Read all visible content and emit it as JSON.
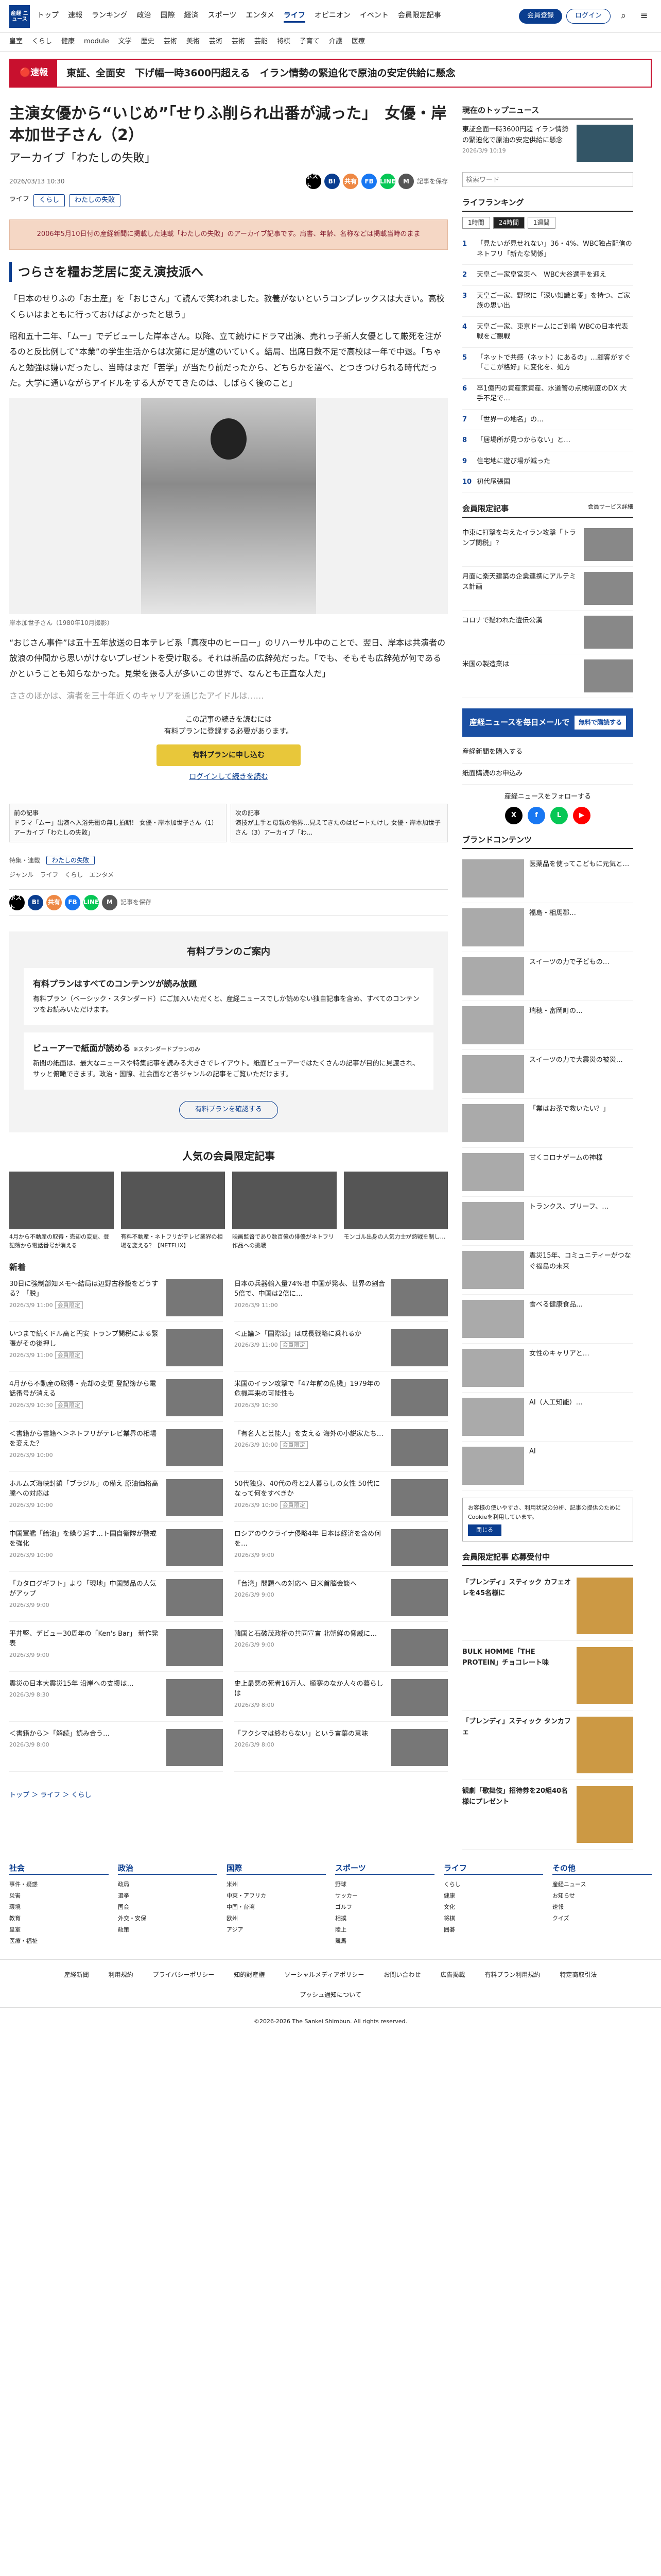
{
  "header": {
    "logo": "産経\nニュース",
    "nav": [
      "トップ",
      "速報",
      "ランキング",
      "政治",
      "国際",
      "経済",
      "スポーツ",
      "エンタメ",
      "ライフ",
      "オピニオン",
      "イベント",
      "会員限定記事"
    ],
    "active": "ライフ",
    "member": "会員登録",
    "login": "ログイン",
    "menu": "メニュー"
  },
  "subnav": [
    "皇室",
    "くらし",
    "健康",
    "module",
    "文学",
    "歴史",
    "芸術",
    "美術",
    "芸術",
    "芸術",
    "芸能",
    "将棋",
    "子育て",
    "介護",
    "医療"
  ],
  "breaking": {
    "label": "速報",
    "text": "東証、全面安　下げ幅一時3600円超える　イラン情勢の緊迫化で原油の安定供給に懸念"
  },
  "article": {
    "title": "主演女優から“いじめ”「せりふ削られ出番が減った」　女優・岸本加世子さん（2）",
    "subtitle": "アーカイブ「わたしの失敗」",
    "date": "2026/03/13 10:30",
    "share": [
      "ポスト",
      "B!",
      "共有",
      "FB",
      "LINE",
      "M",
      "記事を保存"
    ],
    "tags": [
      "ライフ",
      "くらし",
      "わたしの失敗"
    ],
    "notice": "2006年5月10日付の産経新聞に掲載した連載「わたしの失敗」のアーカイブ記事です。肩書、年齢、名称などは掲載当時のまま",
    "section": "つらさを糧お芝居に変え演技派へ",
    "paras": [
      "「日本のせりふの「お土産」を「おじさん」て読んで笑われました。教養がないというコンプレックスは大きい。高校くらいはまともに行っておけばよかったと思う」",
      "昭和五十二年、「ムー」でデビューした岸本さん。以降、立て続けにドラマ出演、売れっ子新人女優として厳死を注がるのと反比例して“本業”の学生生活からは次第に足が遠のいていく。結局、出席日数不足で高校は一年で中退。「ちゃんと勉強は嫌いだったし、当時はまだ「苦学」が当たり前だったから、どちらかを選べ、とつきつけられる時代だった。大学に通いながらアイドルをする人がでてきたのは、しばらく後のこと」"
    ],
    "caption": "岸本加世子さん（1980年10月撮影）",
    "para2": "“おじさん事件”は五十五年放送の日本テレビ系「真夜中のヒーロー」のリハーサル中のことで、翌日、岸本は共演者の放浪の仲間から思いがけないプレゼントを受け取る。それは新品の広辞苑だった。「でも、そもそも広辞苑が何であるかということも知らなかった。見栄を張る人が多いこの世界で、なんとも正直な人だ」",
    "faded": "ささのほかは、演者を三十年近くのキャリアを通じたアイドルは……",
    "pay_text": "この記事の続きを読むには\n有料プランに登録する必要があります。",
    "pay_btn": "有料プランに申し込む",
    "pay_login": "ログインして続きを読む",
    "prev": "前の記事\nドラマ「ムー」出演へ入浴先衝の無し拍期！ 女優・岸本加世子さん（1）アーカイブ「わたしの失敗」",
    "next": "次の記事\n演技が上手と母親の他界…見えてきたのはビートたけし 女優・岸本加世子さん（3）アーカイブ「わ...",
    "special_lbl": "特集・連載",
    "special": "わたしの失敗",
    "genre_lbl": "ジャンル",
    "genre": "ライフ　くらし　エンタメ"
  },
  "plan": {
    "title": "有料プランのご案内",
    "c1h": "有料プランはすべてのコンテンツが読み放題",
    "c1": "有料プラン（ベーシック・スタンダード）にご加入いただくと、産経ニュースでしか読めない独自記事を含め、すべてのコンテンツをお読みいただけます。",
    "c2h": "ビューアーで紙面が読める",
    "c2tag": "※スタンダードプランのみ",
    "c2": "新聞の紙面は、最大なニュースや特集記事を読みる大きさでレイアウト。紙面ビューアーではたくさんの記事が目的に見渡され、サッと俯瞰できます。政治・国際、社会面など各ジャンルの記事をご覧いただけます。",
    "btn": "有料プランを確認する"
  },
  "popular": {
    "title": "人気の会員限定記事",
    "items": [
      "4月から不動産の取得・売却の変更、登記簿から電話番号が消える",
      "有料不動産・ネトフリがテレビ業界の相場を変える？【NETFLIX】",
      "映画監督であり数百億の俳優がネトフリ作品への挑戦",
      "モンゴル出身の人気力士が熱戦を制し…"
    ]
  },
  "news": {
    "title": "新着",
    "items": [
      {
        "t": "30日に強制部知メモ～結局は辺野古移設をどうする？「脱」",
        "d": "2026/3/9 11:00",
        "tg": "会員限定"
      },
      {
        "t": "日本の兵器輸入量74%増 中国が発表、世界の割合5倍で、中国は2倍に…",
        "d": "2026/3/9 11:00",
        "tg": ""
      },
      {
        "t": "いつまで続くドル高と円安 トランプ関税による緊張がその後押し",
        "d": "2026/3/9 11:00",
        "tg": "会員限定"
      },
      {
        "t": "＜正論＞「国際派」は成長戦略に乗れるか",
        "d": "2026/3/9 11:00",
        "tg": "会員限定"
      },
      {
        "t": "4月から不動産の取得・売却の変更 登記簿から電話番号が消える",
        "d": "2026/3/9 10:30",
        "tg": "会員限定"
      },
      {
        "t": "米国のイラン攻撃で「47年前の危機」1979年の危機再来の可能性も",
        "d": "2026/3/9 10:30",
        "tg": ""
      },
      {
        "t": "＜書籍から書籍へ＞ネトフリがテレビ業界の相場を変えた？",
        "d": "2026/3/9 10:00",
        "tg": ""
      },
      {
        "t": "「有名人と芸能人」を支える 海外の小説家たち…",
        "d": "2026/3/9 10:00",
        "tg": "会員限定"
      },
      {
        "t": "ホルムズ海峡封鎖「ブラジル」の備え 原油価格高騰への対応は",
        "d": "2026/3/9 10:00",
        "tg": ""
      },
      {
        "t": "50代独身、40代の母と2人暮らしの女性 50代になって何をすべきか",
        "d": "2026/3/9 10:00",
        "tg": "会員限定"
      },
      {
        "t": "中国軍艦「給油」を繰り返す…ト国自衛隊が警戒を強化",
        "d": "2026/3/9 10:00",
        "tg": ""
      },
      {
        "t": "ロシアのウクライナ侵略4年 日本は経済を含め何を…",
        "d": "2026/3/9 9:00",
        "tg": ""
      },
      {
        "t": "「カタログギフト」より「現地」中国製品の人気がアップ",
        "d": "2026/3/9 9:00",
        "tg": ""
      },
      {
        "t": "「台湾」問題への対応へ 日米首脳会談へ",
        "d": "2026/3/9 9:00",
        "tg": ""
      },
      {
        "t": "平井堅、デビュー30周年の「Ken's Bar」 新作発表",
        "d": "2026/3/9 9:00",
        "tg": ""
      },
      {
        "t": "韓国と石破茂政権の共同宣言 北朝鮮の脅威に…",
        "d": "2026/3/9 9:00",
        "tg": ""
      },
      {
        "t": "震災の日本大震災15年 沿岸への支援は…",
        "d": "2026/3/9 8:30",
        "tg": ""
      },
      {
        "t": "史上最悪の死者16万人、極寒のなか人々の暮らしは",
        "d": "2026/3/9 8:00",
        "tg": ""
      },
      {
        "t": "＜書籍から＞「解読」読み合う…",
        "d": "2026/3/9 8:00",
        "tg": ""
      },
      {
        "t": "「フクシマは終わらない」という言葉の意味",
        "d": "2026/3/9 8:00",
        "tg": ""
      }
    ]
  },
  "crumb": "トップ ＞ ライフ ＞ くらし",
  "footer": {
    "cols": [
      {
        "h": "社会",
        "items": [
          "事件・疑惑",
          "災害",
          "環境",
          "教育",
          "皇室",
          "医療・福祉"
        ]
      },
      {
        "h": "政治",
        "items": [
          "政局",
          "選挙",
          "国会",
          "外交・安保",
          "政策"
        ]
      },
      {
        "h": "国際",
        "items": [
          "米州",
          "中東・アフリカ",
          "中国・台湾",
          "欧州",
          "アジア"
        ]
      },
      {
        "h": "スポーツ",
        "items": [
          "野球",
          "サッカー",
          "ゴルフ",
          "相撲",
          "陸上",
          "競馬"
        ]
      },
      {
        "h": "ライフ",
        "items": [
          "くらし",
          "健康",
          "文化",
          "将棋",
          "囲碁"
        ]
      },
      {
        "h": "その他",
        "items": [
          "産経ニュース",
          "お知らせ",
          "速報",
          "クイズ"
        ]
      }
    ],
    "bar": [
      "産経新聞",
      "利用規約",
      "プライバシーポリシー",
      "知的財産権",
      "ソーシャルメディアポリシー",
      "お問い合わせ",
      "広告掲載",
      "有料プラン利用規約",
      "特定商取引法"
    ],
    "push": "プッシュ通知について",
    "copy": "©2026-2026 The Sankei Shimbun. All rights reserved."
  },
  "side": {
    "now": "現在のトップニュース",
    "nowtxt": "東証全面一時3600円超 イラン情勢の緊迫化で原油の安定供給に懸念",
    "nowdate": "2026/3/9 10:19",
    "search_ph": "検索ワード",
    "rank_title": "ライフランキング",
    "rank_tabs": [
      "1時間",
      "24時間",
      "1週間"
    ],
    "rank": [
      "「見たいが見せれない」36・4%、WBC独占配信のネトフリ「新たな関係」",
      "天皇ご一家皇宮東へ　WBC大谷選手を迎え",
      "天皇ご一家、野球に「深い知識と愛」を持つ、ご家族の思い出",
      "天皇ご一家、東京ドームにご到着 WBCの日本代表戦をご観戦",
      "「ネットで共感（ネット）にあるの」…顧客がすぐ「ここが格好」に変化を、処方",
      "卒1億円の資産家資産、水道管の点検制度のDX 大手不足で…",
      "「世界一の地名」の…",
      "「居場所が見つからない」と…",
      "住宅地に遊び場が減った",
      "初代尾張国"
    ],
    "mem_title": "会員限定記事",
    "mem_more": "会員サービス詳細",
    "mem": [
      "中東に打撃を与えたイラン攻撃「トランプ関税」？",
      "月面に楽天建築の企業連携にアルテミス計画",
      "コロナで疑われた遺伝公漢",
      "米国の製造業は"
    ],
    "banner": "産経ニュースを毎日メールで",
    "banner_btn": "無料で購読する",
    "links": [
      "産経新聞を購入する",
      "紙面購読のお申込み"
    ],
    "follow": "産経ニュースをフォローする",
    "brand": "ブランドコンテンツ",
    "pr": [
      "医薬品を使ってこどもに元気と…",
      "福島・相馬郡…",
      "スイーツの力で子どもの…",
      "瑞穂・富岡町の…",
      "スイーツの力で大震災の被災…",
      "「業はお茶で救いたい？」",
      "甘くコロナゲームの神様",
      "トランクス、ブリーフ、…",
      "震災15年、コミュニティーがつなぐ福島の未来",
      "食べる健康食品…",
      "女性のキャリアと…",
      "AI（人工知能）…",
      "AI"
    ],
    "cookie": "お客様の使いやすさ、利用状況の分析、記事の提供のためにCookieを利用しています。",
    "cookie_ok": "閉じる",
    "prz_title": "会員限定記事 応募受付中",
    "prz": [
      "「ブレンディ」スティック カフェオレを45名様に",
      "BULK HOMME「THE PROTEIN」チョコレート味",
      "「ブレンディ」スティック タンカフェ",
      "観劇「歌舞伎」招待券を20組40名様にプレゼント"
    ]
  }
}
